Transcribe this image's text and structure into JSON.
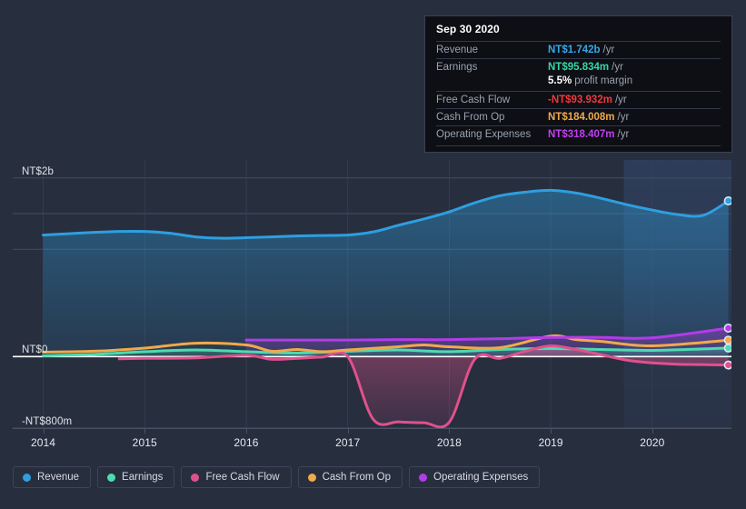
{
  "tooltip": {
    "date": "Sep 30 2020",
    "rows": [
      {
        "label": "Revenue",
        "value": "NT$1.742b",
        "unit": "/yr",
        "color": "#34a8ea"
      },
      {
        "label": "Earnings",
        "value": "NT$95.834m",
        "unit": "/yr",
        "color": "#36d6a6"
      },
      {
        "label": "",
        "value": "5.5%",
        "unit": "profit margin",
        "color": "#ffffff"
      },
      {
        "label": "Free Cash Flow",
        "value": "-NT$93.932m",
        "unit": "/yr",
        "color": "#f0383d"
      },
      {
        "label": "Cash From Op",
        "value": "NT$184.008m",
        "unit": "/yr",
        "color": "#f0a94c"
      },
      {
        "label": "Operating Expenses",
        "value": "NT$318.407m",
        "unit": "/yr",
        "color": "#c23ef0"
      }
    ]
  },
  "legend": [
    {
      "label": "Revenue",
      "color": "#2e9fe0"
    },
    {
      "label": "Earnings",
      "color": "#4ddbb0"
    },
    {
      "label": "Free Cash Flow",
      "color": "#e0518c"
    },
    {
      "label": "Cash From Op",
      "color": "#f0a94c"
    },
    {
      "label": "Operating Expenses",
      "color": "#b23ce8"
    }
  ],
  "axes": {
    "y_labels": [
      {
        "text": "NT$2b",
        "value": 2000
      },
      {
        "text": "NT$0",
        "value": 0
      },
      {
        "text": "-NT$800m",
        "value": -800
      }
    ],
    "x_labels": [
      "2014",
      "2015",
      "2016",
      "2017",
      "2018",
      "2019",
      "2020"
    ]
  },
  "chart_data": {
    "type": "area",
    "title": "",
    "xlabel": "",
    "ylabel": "NT$",
    "unit": "NT$ millions per year",
    "ylim": [
      -800,
      2200
    ],
    "xlim": [
      "2013.7",
      "2020.75"
    ],
    "grid": true,
    "legend_position": "bottom",
    "y_ticks": [
      2000,
      1600,
      1200,
      800,
      0,
      -800
    ],
    "y_tick_labels": [
      "NT$2b",
      "",
      "",
      "",
      "NT$0",
      "-NT$800m"
    ],
    "x_ticks": [
      "2014",
      "2015",
      "2016",
      "2017",
      "2018",
      "2019",
      "2020"
    ],
    "highlight_region": {
      "from": "2019.75",
      "to": "2020.75",
      "note": "shaded recent period"
    },
    "marker_date": "Sep 30 2020",
    "series": [
      {
        "name": "Revenue",
        "color": "#2e9fe0",
        "filled": true,
        "x": [
          2014.0,
          2014.25,
          2014.5,
          2014.75,
          2015.0,
          2015.25,
          2015.5,
          2015.75,
          2016.0,
          2016.25,
          2016.5,
          2016.75,
          2017.0,
          2017.25,
          2017.5,
          2017.75,
          2018.0,
          2018.25,
          2018.5,
          2018.75,
          2019.0,
          2019.25,
          2019.5,
          2019.75,
          2020.0,
          2020.25,
          2020.5,
          2020.75
        ],
        "values": [
          1360,
          1375,
          1390,
          1400,
          1400,
          1380,
          1340,
          1325,
          1330,
          1340,
          1350,
          1355,
          1360,
          1395,
          1470,
          1540,
          1620,
          1720,
          1800,
          1840,
          1860,
          1830,
          1770,
          1700,
          1640,
          1590,
          1580,
          1742
        ]
      },
      {
        "name": "Earnings",
        "color": "#4ddbb0",
        "filled": true,
        "x": [
          2014.0,
          2014.5,
          2015.0,
          2015.5,
          2016.0,
          2016.5,
          2017.0,
          2017.5,
          2018.0,
          2018.5,
          2019.0,
          2019.5,
          2020.0,
          2020.75
        ],
        "values": [
          10,
          25,
          55,
          75,
          55,
          40,
          60,
          75,
          55,
          80,
          90,
          80,
          70,
          95.834
        ]
      },
      {
        "name": "Free Cash Flow",
        "color": "#e0518c",
        "filled": true,
        "x": [
          2014.75,
          2015.0,
          2015.5,
          2016.0,
          2016.25,
          2016.5,
          2016.75,
          2017.0,
          2017.25,
          2017.5,
          2017.75,
          2018.0,
          2018.25,
          2018.5,
          2018.75,
          2019.0,
          2019.25,
          2019.5,
          2019.75,
          2020.0,
          2020.25,
          2020.5,
          2020.75
        ],
        "values": [
          -25,
          -20,
          -15,
          15,
          -30,
          -20,
          -5,
          0,
          -700,
          -730,
          -740,
          -735,
          -30,
          -20,
          60,
          120,
          80,
          20,
          -40,
          -70,
          -85,
          -90,
          -93.932
        ]
      },
      {
        "name": "Cash From Op",
        "color": "#f0a94c",
        "filled": false,
        "x": [
          2014.0,
          2014.5,
          2015.0,
          2015.5,
          2016.0,
          2016.25,
          2016.5,
          2016.75,
          2017.0,
          2017.5,
          2017.75,
          2018.0,
          2018.5,
          2019.0,
          2019.25,
          2019.5,
          2020.0,
          2020.75
        ],
        "values": [
          50,
          60,
          95,
          150,
          130,
          60,
          80,
          55,
          75,
          110,
          130,
          110,
          100,
          230,
          190,
          170,
          120,
          184.008
        ]
      },
      {
        "name": "Operating Expenses",
        "color": "#b23ce8",
        "filled": true,
        "x": [
          2016.0,
          2016.5,
          2017.0,
          2017.5,
          2018.0,
          2018.5,
          2019.0,
          2019.5,
          2020.0,
          2020.75
        ],
        "values": [
          185,
          185,
          185,
          190,
          190,
          200,
          215,
          215,
          210,
          318.407
        ]
      }
    ]
  }
}
